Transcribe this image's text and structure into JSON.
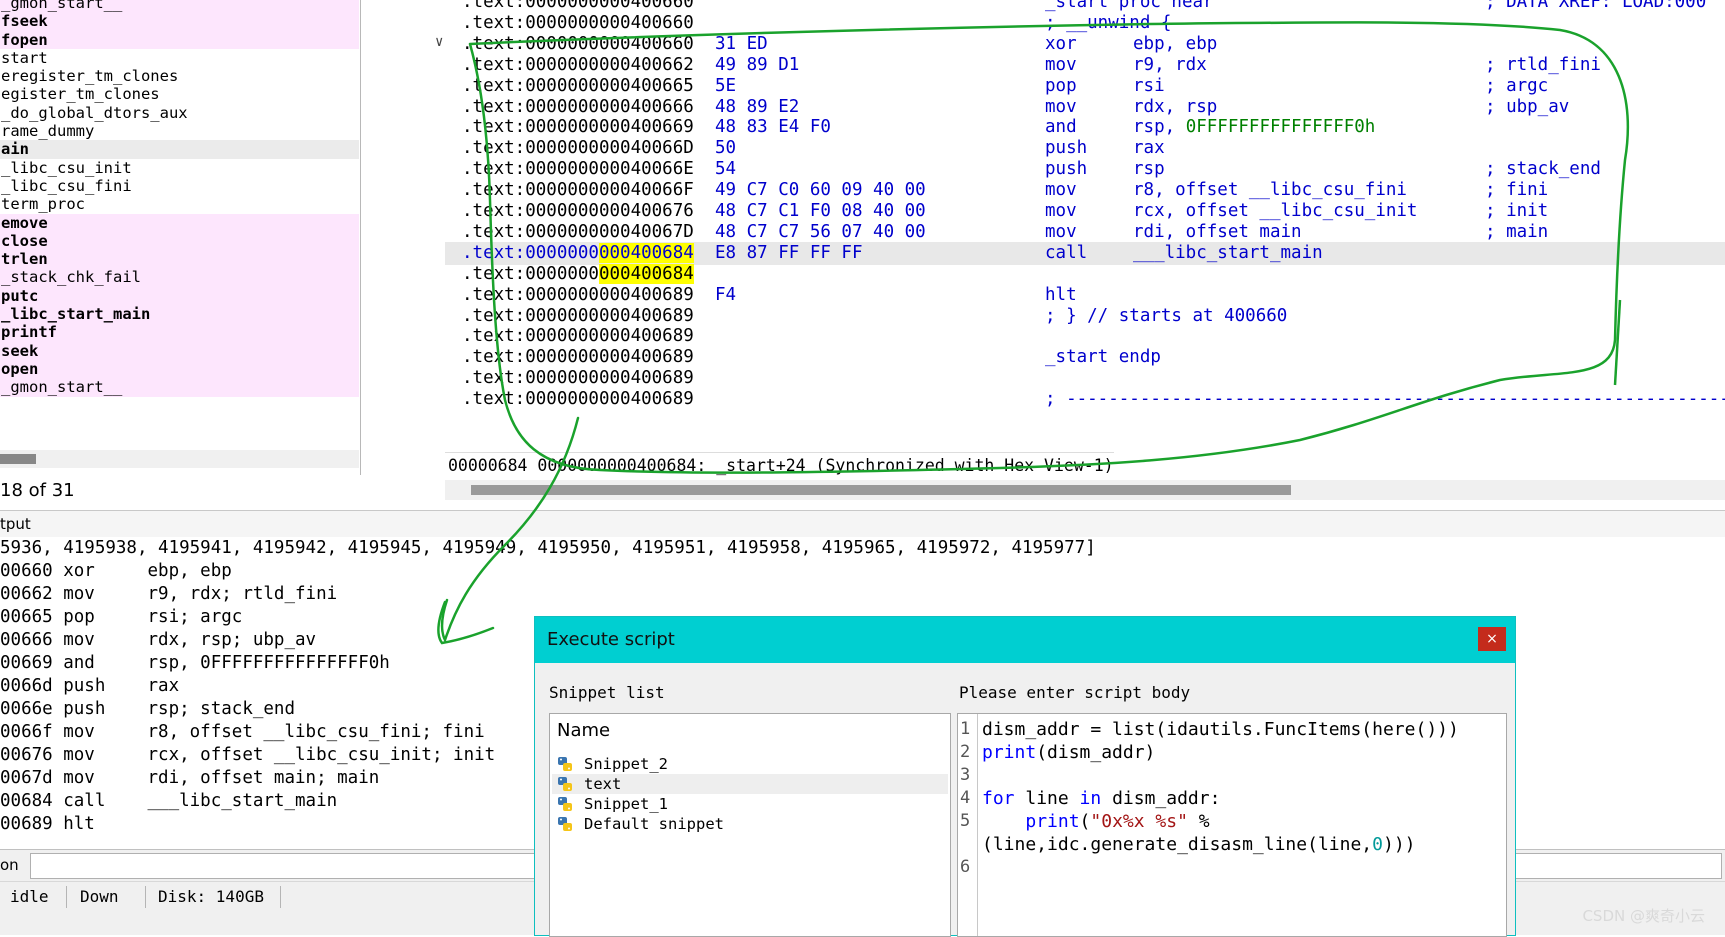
{
  "functions": {
    "items": [
      {
        "name": "_gmon_start__",
        "pink": true,
        "bold": false
      },
      {
        "name": "fseek",
        "pink": true,
        "bold": true
      },
      {
        "name": "fopen",
        "pink": true,
        "bold": true
      },
      {
        "name": "start",
        "pink": false,
        "bold": false
      },
      {
        "name": "eregister_tm_clones",
        "pink": false,
        "bold": false
      },
      {
        "name": "egister_tm_clones",
        "pink": false,
        "bold": false
      },
      {
        "name": "_do_global_dtors_aux",
        "pink": false,
        "bold": false
      },
      {
        "name": "rame_dummy",
        "pink": false,
        "bold": false
      },
      {
        "name": "ain",
        "pink": false,
        "bold": true,
        "selected": true
      },
      {
        "name": "_libc_csu_init",
        "pink": false,
        "bold": false
      },
      {
        "name": "_libc_csu_fini",
        "pink": false,
        "bold": false
      },
      {
        "name": "term_proc",
        "pink": false,
        "bold": false
      },
      {
        "name": "emove",
        "pink": true,
        "bold": true
      },
      {
        "name": "close",
        "pink": true,
        "bold": true
      },
      {
        "name": "trlen",
        "pink": true,
        "bold": true
      },
      {
        "name": "_stack_chk_fail",
        "pink": true,
        "bold": false
      },
      {
        "name": "putc",
        "pink": true,
        "bold": true
      },
      {
        "name": "_libc_start_main",
        "pink": true,
        "bold": true
      },
      {
        "name": "printf",
        "pink": true,
        "bold": true
      },
      {
        "name": "seek",
        "pink": true,
        "bold": true
      },
      {
        "name": "open",
        "pink": true,
        "bold": true
      },
      {
        "name": "_gmon_start__",
        "pink": true,
        "bold": false
      }
    ],
    "count_text": "18 of 31"
  },
  "disasm": {
    "lines": [
      {
        "addr": ".text:0000000000400660",
        "bytes": "",
        "mn": "",
        "ops": "",
        "comment": "",
        "raw": "_start proc near",
        "rawc": "; DATA XREF: LOAD:000"
      },
      {
        "addr": ".text:0000000000400660",
        "bytes": "",
        "mn": "",
        "ops": "",
        "comment": "",
        "raw": "; __unwind {"
      },
      {
        "addr": ".text:0000000000400660",
        "bytes": "31 ED",
        "mn": "xor",
        "ops": "ebp, ebp",
        "comment": ""
      },
      {
        "addr": ".text:0000000000400662",
        "bytes": "49 89 D1",
        "mn": "mov",
        "ops": "r9, rdx",
        "comment": "; rtld_fini"
      },
      {
        "addr": ".text:0000000000400665",
        "bytes": "5E",
        "mn": "pop",
        "ops": "rsi",
        "comment": "; argc"
      },
      {
        "addr": ".text:0000000000400666",
        "bytes": "48 89 E2",
        "mn": "mov",
        "ops": "rdx, rsp",
        "comment": "; ubp_av"
      },
      {
        "addr": ".text:0000000000400669",
        "bytes": "48 83 E4 F0",
        "mn": "and",
        "ops": "rsp, ",
        "num": "0FFFFFFFFFFFFFFF0h",
        "comment": ""
      },
      {
        "addr": ".text:000000000040066D",
        "bytes": "50",
        "mn": "push",
        "ops": "rax",
        "comment": ""
      },
      {
        "addr": ".text:000000000040066E",
        "bytes": "54",
        "mn": "push",
        "ops": "rsp",
        "comment": "; stack_end"
      },
      {
        "addr": ".text:000000000040066F",
        "bytes": "49 C7 C0 60 09 40 00",
        "mn": "mov",
        "ops": "r8, offset __libc_csu_fini",
        "comment": "; fini"
      },
      {
        "addr": ".text:0000000000400676",
        "bytes": "48 C7 C1 F0 08 40 00",
        "mn": "mov",
        "ops": "rcx, offset __libc_csu_init",
        "comment": "; init"
      },
      {
        "addr": ".text:000000000040067D",
        "bytes": "48 C7 C7 56 07 40 00",
        "mn": "mov",
        "ops": "rdi, offset main",
        "comment": "; main"
      },
      {
        "addr_a": ".text:0000000",
        "addr_b": "000400684",
        "bytes": "E8 87 FF FF FF",
        "mn": "call",
        "ops": "___libc_start_main",
        "comment": "",
        "current": true
      },
      {
        "addr_a": ".text:0000000",
        "addr_b": "000400684",
        "bytes": "",
        "mn": "",
        "ops": "",
        "comment": ""
      },
      {
        "addr": ".text:0000000000400689",
        "bytes": "F4",
        "mn": "hlt",
        "ops": "",
        "comment": ""
      },
      {
        "addr": ".text:0000000000400689",
        "bytes": "",
        "mn": "",
        "ops": "",
        "comment": "",
        "raw": "; } // starts at 400660"
      },
      {
        "addr": ".text:0000000000400689",
        "bytes": "",
        "mn": "",
        "ops": "",
        "comment": ""
      },
      {
        "addr": ".text:0000000000400689",
        "bytes": "",
        "mn": "",
        "ops": "",
        "comment": "",
        "raw": "_start endp"
      },
      {
        "addr": ".text:0000000000400689",
        "bytes": "",
        "mn": "",
        "ops": "",
        "comment": ""
      },
      {
        "addr": ".text:0000000000400689",
        "bytes": "",
        "mn": "",
        "ops": "",
        "comment": "",
        "raw": "; ---------------------------------------------------------------"
      }
    ],
    "status": "00000684 0000000000400684: _start+24 (Synchronized with Hex View-1)"
  },
  "output": {
    "header": "tput",
    "lines": [
      "5936, 4195938, 4195941, 4195942, 4195945, 4195949, 4195950, 4195951, 4195958, 4195965, 4195972, 4195977]",
      "00660 xor     ebp, ebp",
      "00662 mov     r9, rdx; rtld_fini",
      "00665 pop     rsi; argc",
      "00666 mov     rdx, rsp; ubp_av",
      "00669 and     rsp, 0FFFFFFFFFFFFFFF0h",
      "0066d push    rax",
      "0066e push    rsp; stack_end",
      "0066f mov     r8, offset __libc_csu_fini; fini",
      "00676 mov     rcx, offset __libc_csu_init; init",
      "0067d mov     rdi, offset main; main",
      "00684 call    ___libc_start_main",
      "00689 hlt"
    ],
    "cmd_label": "on"
  },
  "statusbar": {
    "state": "idle",
    "direction": "Down",
    "disk": "Disk: 140GB"
  },
  "dialog": {
    "title": "Execute script",
    "close_glyph": "×",
    "snippet_label": "Snippet list",
    "name_header": "Name",
    "snippets": [
      {
        "name": "Snippet_2",
        "selected": false
      },
      {
        "name": "text",
        "selected": true
      },
      {
        "name": "Snippet_1",
        "selected": false
      },
      {
        "name": "Default snippet",
        "selected": false
      }
    ],
    "body_label": "Please enter script body",
    "line_numbers": [
      "1",
      "2",
      "3",
      "4",
      "5",
      "",
      "6"
    ],
    "code": {
      "l1": "dism_addr = list(idautils.FuncItems(here()))",
      "l2_kw": "print",
      "l2_rest": "(dism_addr)",
      "l4_for": "for",
      "l4_mid": " line ",
      "l4_in": "in",
      "l4_rest": " dism_addr:",
      "l5_indent": "    ",
      "l5_kw": "print",
      "l5_open": "(",
      "l5_str": "\"0x%x %s\"",
      "l5_rest": " %",
      "l6_a": "(line,idc.generate_disasm_line(line,",
      "l6_zero": "0",
      "l6_b": ")))"
    }
  },
  "watermark": "CSDN @爽奇小云",
  "colors": {
    "dialog_title": "#00cfd1",
    "annotation_green": "#1aa22c",
    "highlight": "#ffff00",
    "pink_row": "#fde6fd"
  }
}
